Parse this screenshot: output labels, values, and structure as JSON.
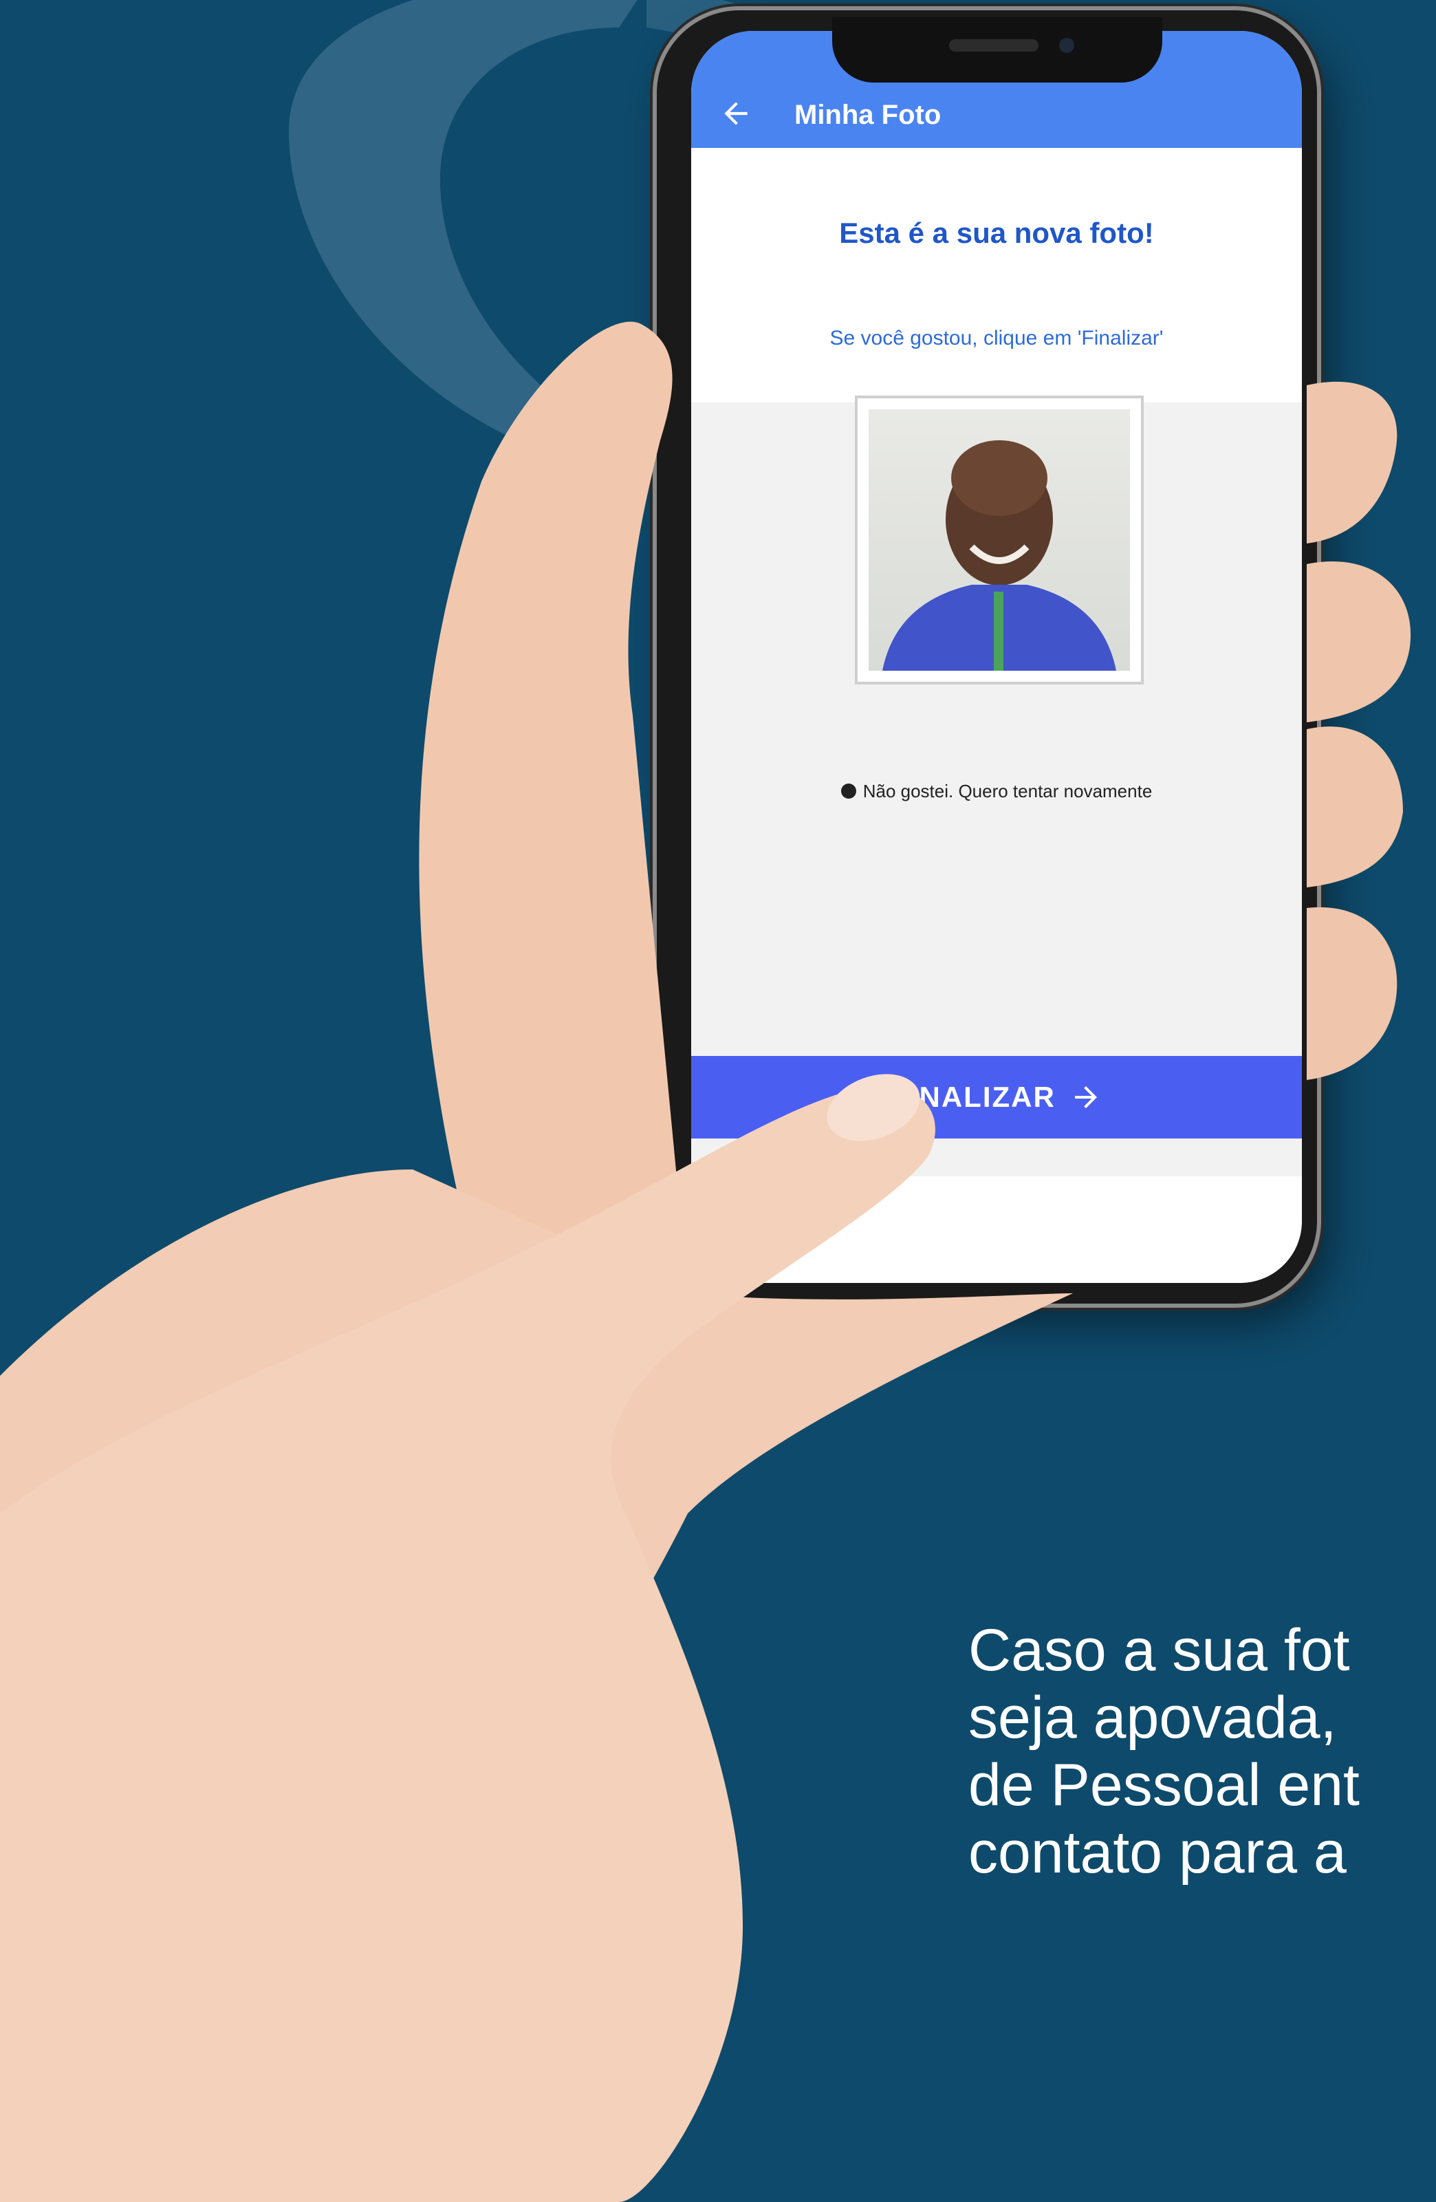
{
  "app": {
    "title": "Minha Foto",
    "headline": "Esta é a sua nova foto!",
    "subtext": "Se você gostou, clique em 'Finalizar'",
    "retry_label": "Não gostei. Quero tentar novamente",
    "finalize_label": "FINALIZAR",
    "finalize_icon": "arrow-right-icon",
    "back_icon": "arrow-left-icon"
  },
  "colors": {
    "background": "#0e4a6b",
    "appbar": "#4a84f0",
    "finalize_button": "#4a5ff2",
    "headline": "#1f57c7"
  },
  "caption": {
    "lines": [
      "Caso a sua fot",
      "seja apovada,",
      "de Pessoal ent",
      "contato para a"
    ]
  }
}
